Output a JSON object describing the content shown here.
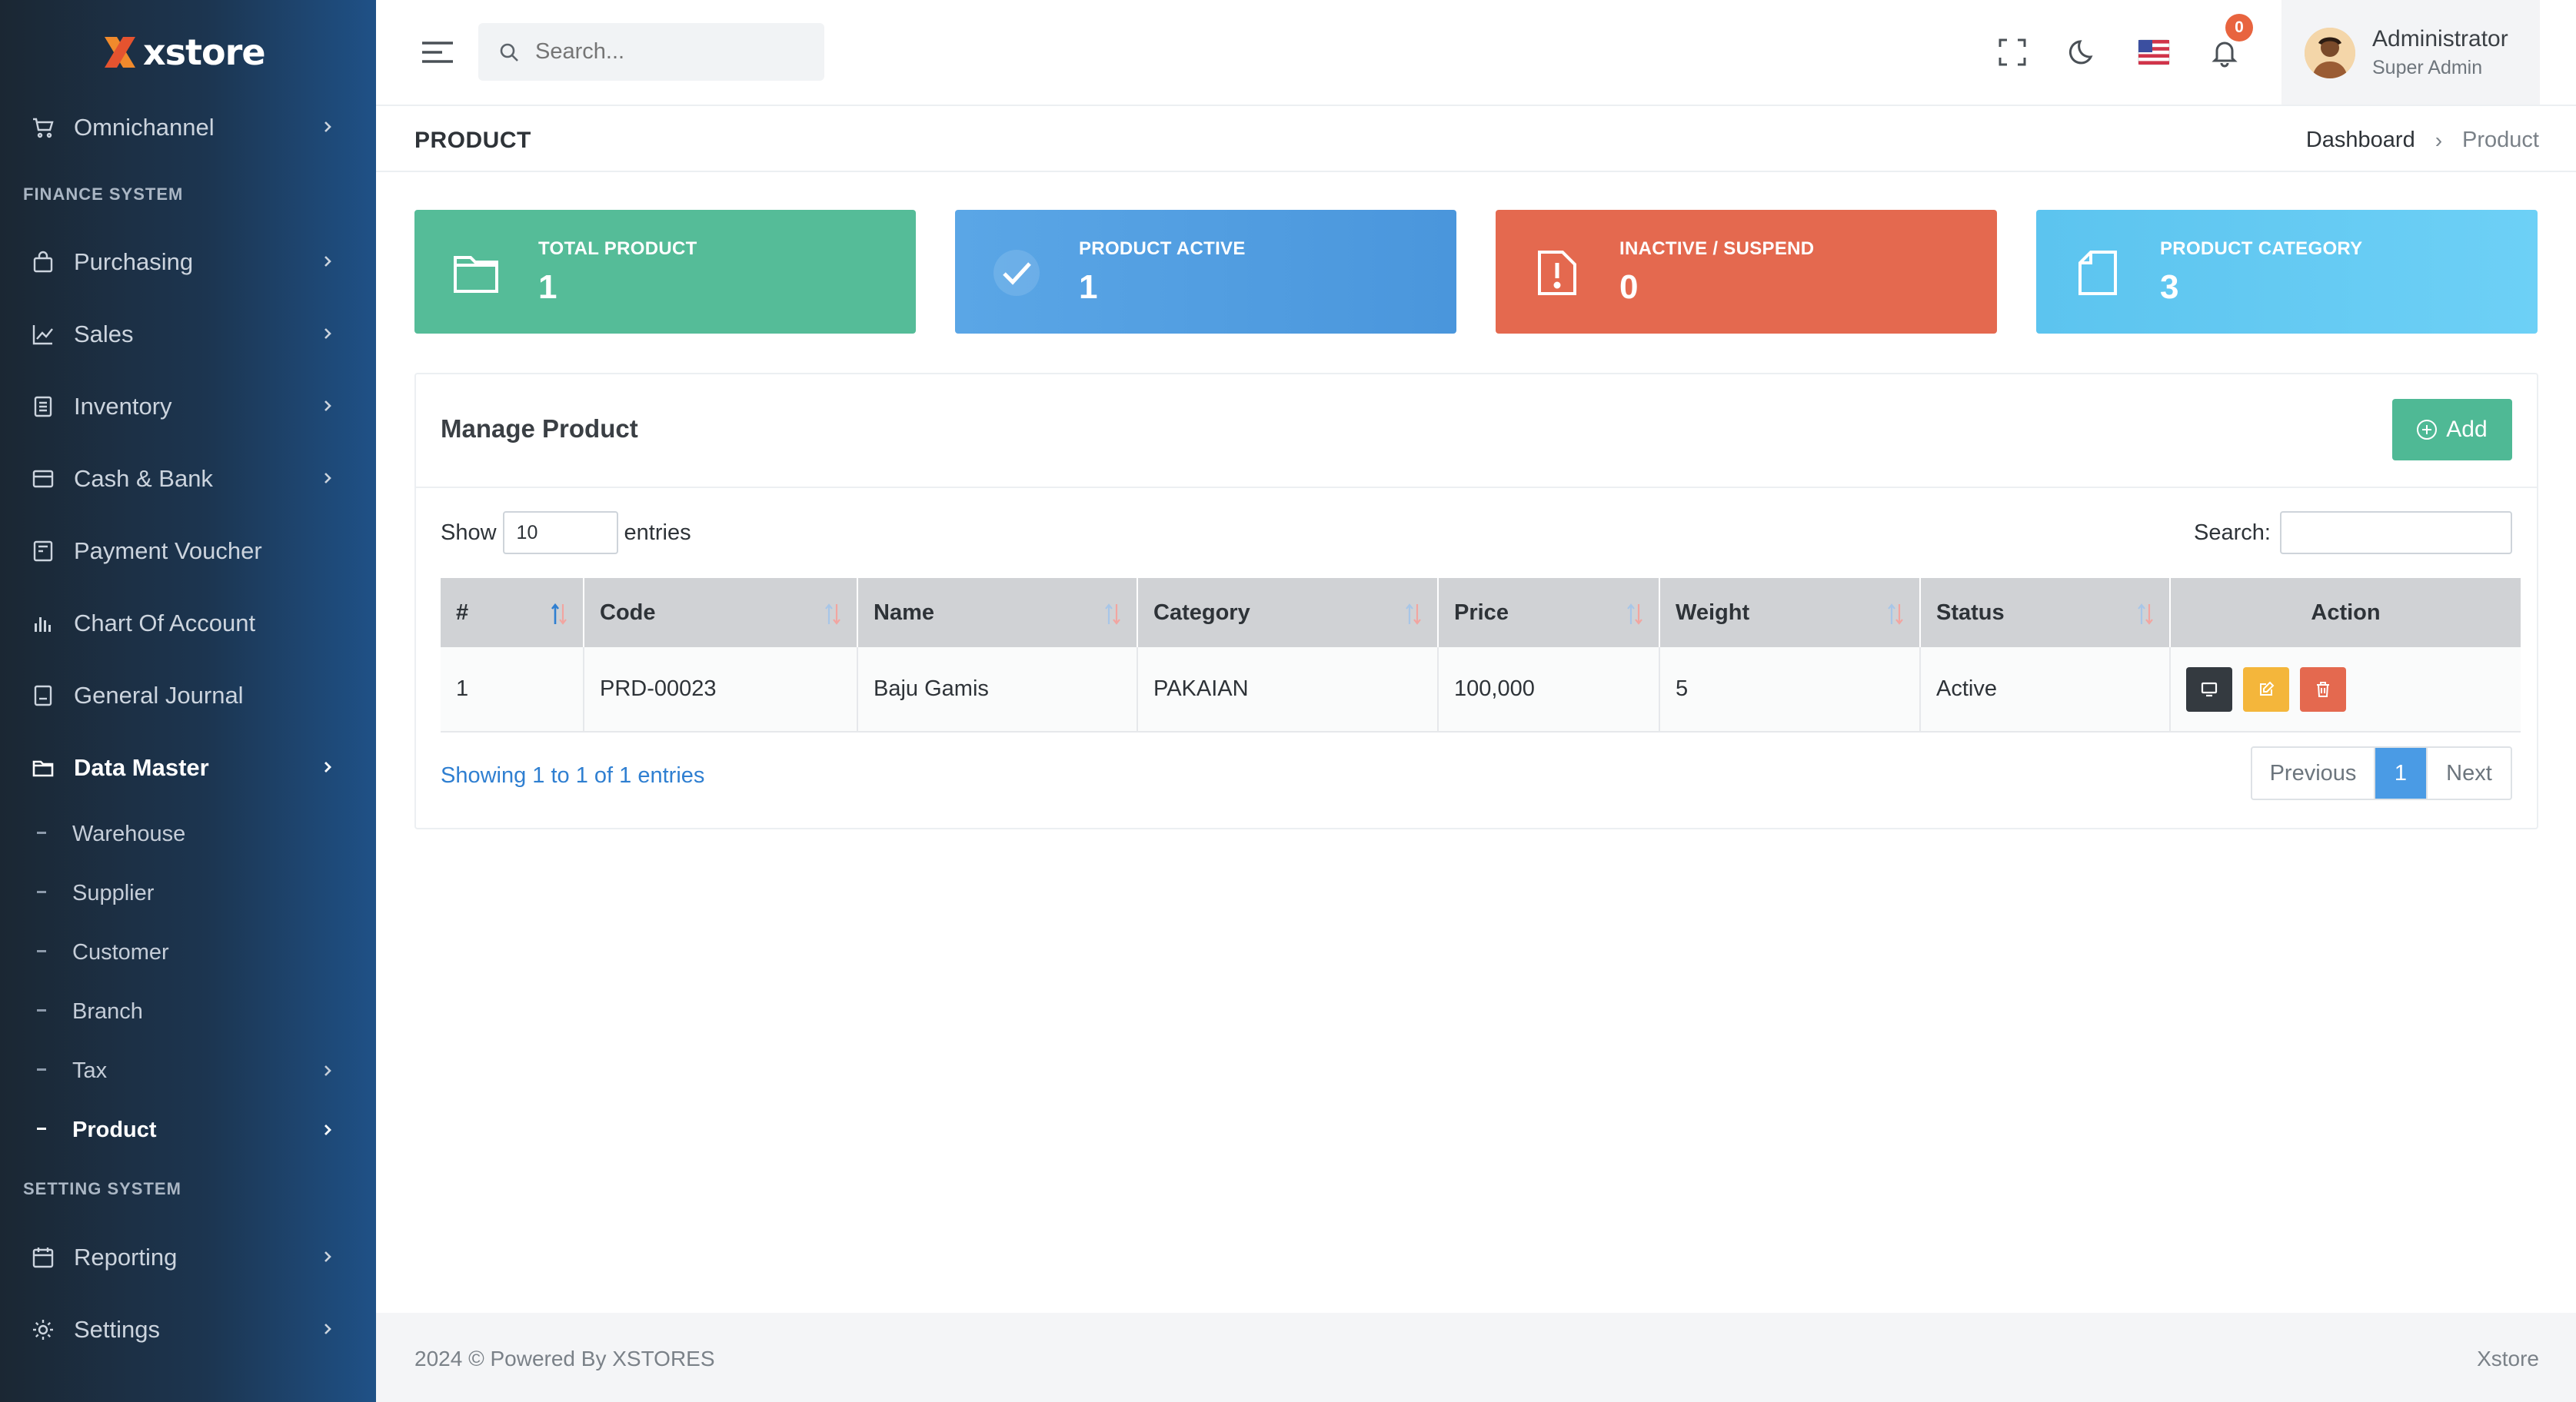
{
  "brand": {
    "name": "xstore"
  },
  "sidebar": {
    "top_items": [
      {
        "label": "Omnichannel",
        "icon": "cart-icon"
      }
    ],
    "section_finance": "FINANCE SYSTEM",
    "finance_items": [
      {
        "label": "Purchasing",
        "icon": "bag-icon"
      },
      {
        "label": "Sales",
        "icon": "chart-line-icon"
      },
      {
        "label": "Inventory",
        "icon": "list-icon"
      },
      {
        "label": "Cash & Bank",
        "icon": "wallet-icon"
      },
      {
        "label": "Payment Voucher",
        "icon": "voucher-icon"
      },
      {
        "label": "Chart Of Account",
        "icon": "bar-chart-icon"
      },
      {
        "label": "General Journal",
        "icon": "journal-icon"
      },
      {
        "label": "Data Master",
        "icon": "folder-icon"
      }
    ],
    "data_master_sub": [
      {
        "label": "Warehouse"
      },
      {
        "label": "Supplier"
      },
      {
        "label": "Customer"
      },
      {
        "label": "Branch"
      },
      {
        "label": "Tax"
      },
      {
        "label": "Product"
      }
    ],
    "section_setting": "SETTING SYSTEM",
    "setting_items": [
      {
        "label": "Reporting",
        "icon": "calendar-icon"
      },
      {
        "label": "Settings",
        "icon": "gear-icon"
      }
    ]
  },
  "header": {
    "search_placeholder": "Search...",
    "notification_count": "0",
    "user_name": "Administrator",
    "user_role": "Super Admin"
  },
  "page": {
    "title": "PRODUCT",
    "breadcrumb_home": "Dashboard",
    "breadcrumb_current": "Product"
  },
  "cards": [
    {
      "label": "TOTAL PRODUCT",
      "value": "1",
      "color": "#55bc98",
      "icon": "folder-icon"
    },
    {
      "label": "PRODUCT ACTIVE",
      "value": "1",
      "color": "#4d9be0",
      "icon": "check-icon"
    },
    {
      "label": "INACTIVE / SUSPEND",
      "value": "0",
      "color": "#e4694f",
      "icon": "alert-icon"
    },
    {
      "label": "PRODUCT CATEGORY",
      "value": "3",
      "color": "#63c9f2",
      "icon": "file-icon"
    }
  ],
  "panel": {
    "title": "Manage Product",
    "add_label": "Add",
    "show_label": "Show",
    "entries_label": "entries",
    "page_length": "10",
    "search_label": "Search:",
    "columns": [
      "#",
      "Code",
      "Name",
      "Category",
      "Price",
      "Weight",
      "Status",
      "Action"
    ],
    "rows": [
      {
        "no": "1",
        "code": "PRD-00023",
        "name": "Baju Gamis",
        "category": "PAKAIAN",
        "price": "100,000",
        "weight": "5",
        "status": "Active"
      }
    ],
    "info": "Showing 1 to 1 of 1 entries",
    "pager": {
      "previous": "Previous",
      "current": "1",
      "next": "Next"
    }
  },
  "footer": {
    "left": "2024 © Powered By XSTORES",
    "right": "Xstore"
  }
}
